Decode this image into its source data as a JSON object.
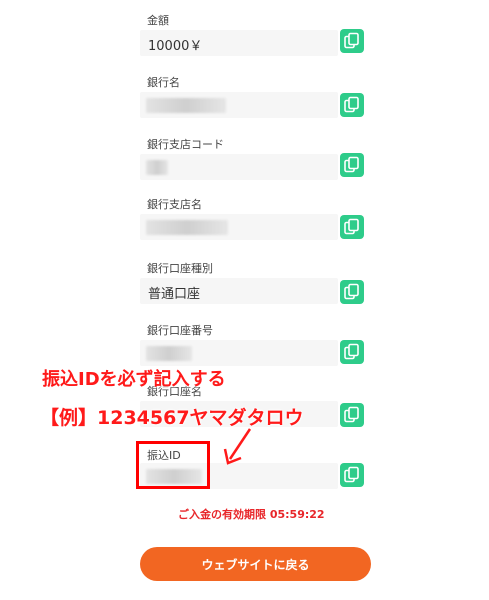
{
  "fields": [
    {
      "label": "金額",
      "value": "10000￥"
    },
    {
      "label": "銀行名",
      "value": ""
    },
    {
      "label": "銀行支店コード",
      "value": ""
    },
    {
      "label": "銀行支店名",
      "value": ""
    },
    {
      "label": "銀行口座種別",
      "value": "普通口座"
    },
    {
      "label": "銀行口座番号",
      "value": ""
    },
    {
      "label": "銀行口座名",
      "value": ""
    },
    {
      "label": "振込ID",
      "value": ""
    }
  ],
  "annotation": {
    "instruction": "振込IDを必ず記入する",
    "example": "【例】1234567ヤマダタロウ"
  },
  "expiry_text": "ご入金の有効期限 05:59:22",
  "back_button_label": "ウェブサイトに戻る",
  "colors": {
    "copy_button": "#2ecc8a",
    "annotation": "#ff1a1a",
    "back_button": "#f26622",
    "expiry": "#e8262a"
  },
  "icons": {
    "copy": "copy-icon",
    "arrow": "arrow-down-left-icon"
  }
}
